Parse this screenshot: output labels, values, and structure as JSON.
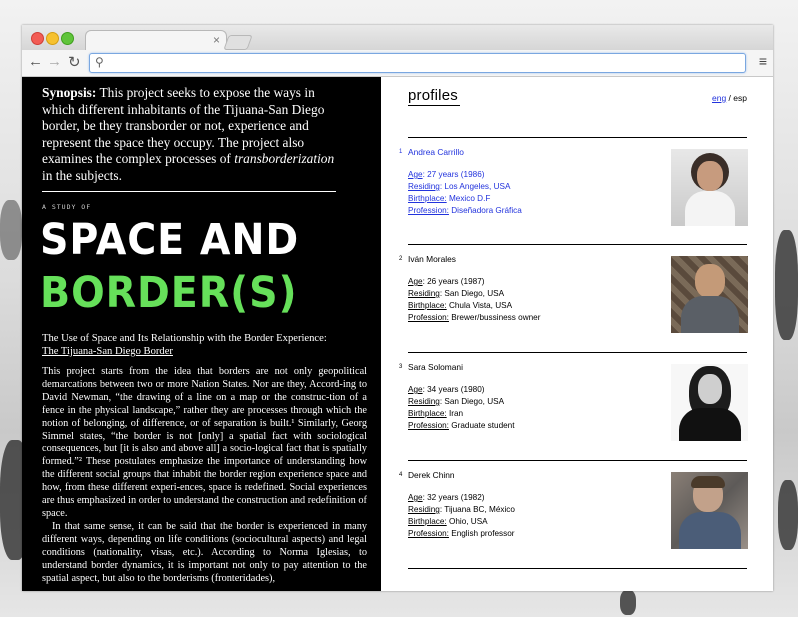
{
  "browser": {
    "url": ""
  },
  "synopsis": {
    "label": "Synopsis:",
    "text": " This project seeks to expose the ways in which different inhabitants of the Tijuana-San Diego border, be they transborder or not, experience and represent the space they occupy. The project also examines the complex processes of ",
    "italic": "transborderization",
    "tail": " in the subjects."
  },
  "hero": {
    "kicker": "A STUDY OF",
    "line1": "SPACE AND",
    "line2": "BORDER(S)",
    "accent_color": "#66e05a",
    "subtitle": "The Use of Space and Its Relationship with the Border Experience:",
    "subtitle_link": "The Tijuana-San Diego Border"
  },
  "essay": {
    "p1": "This project starts from the idea that borders are not only geopolitical demarcations between two or more Nation States. Nor are they, Accord-ing to David Newman, “the drawing of a line on a map or the construc-tion of a fence in the physical landscape,” rather they are processes through which the notion of belonging, of difference, or of separation is built.¹ Similarly, Georg Simmel states, “the border is not [only] a spatial fact with sociological consequences, but [it is also and above all] a socio-logical fact that is spatially formed.”² These postulates emphasize the importance of understanding how the different social groups that inhabit the border region experience space and how, from these different experi-ences, space is redefined. Social experiences are thus emphasized in order to understand the construction and redefinition of space.",
    "p2": "In that same sense, it can be said that the border is experienced in many different ways, depending on life conditions (sociocultural aspects) and legal conditions (nationality, visas, etc.). According to Norma Iglesias, to understand border dynamics, it is important not only to pay attention to the spatial aspect, but also to the borderisms (fronteridades),"
  },
  "profiles_panel": {
    "title": "profiles",
    "lang_active": "eng",
    "lang_sep": " / ",
    "lang_other": "esp",
    "labels": {
      "age": "Age",
      "residing": "Residing",
      "birthplace": "Birthplace:",
      "profession": "Profession:"
    },
    "profiles": [
      {
        "num": "1",
        "name": "Andrea Carrillo",
        "age": ": 27 years (1986)",
        "residing": ": Los Angeles, USA",
        "birthplace": " Mexico D.F",
        "profession": " Diseñadora Gráfica"
      },
      {
        "num": "2",
        "name": "Iván Morales",
        "age": ": 26 years (1987)",
        "residing": ": San Diego, USA",
        "birthplace": " Chula Vista, USA",
        "profession": " Brewer/bussiness owner"
      },
      {
        "num": "3",
        "name": "Sara Solomani",
        "age": ": 34 years (1980)",
        "residing": ": San Diego, USA",
        "birthplace": " Iran",
        "profession": " Graduate student"
      },
      {
        "num": "4",
        "name": "Derek Chinn",
        "age": ": 32 years (1982)",
        "residing": ": Tijuana BC, México",
        "birthplace": " Ohio, USA",
        "profession": " English professor"
      }
    ],
    "link_color": "#2233dd"
  }
}
